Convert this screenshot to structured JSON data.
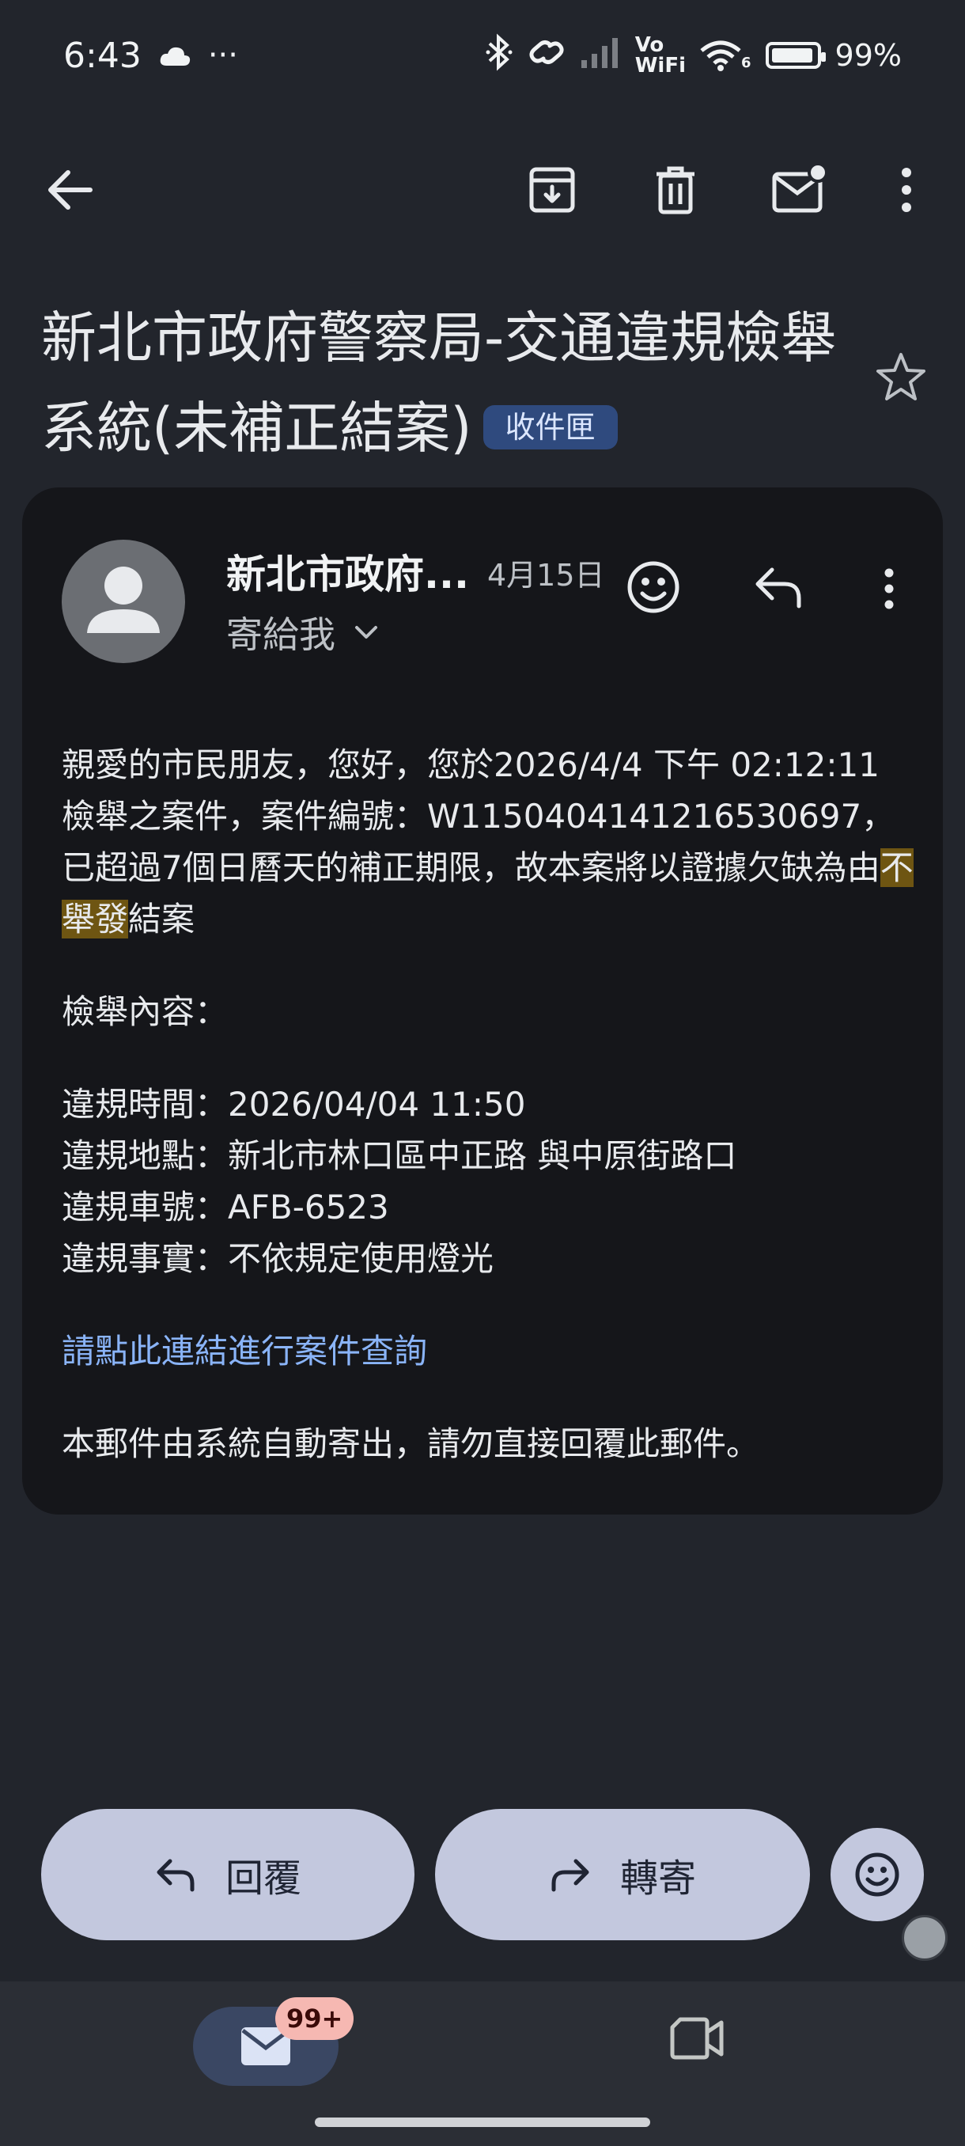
{
  "status_bar": {
    "time": "6:43",
    "more": "···",
    "vo": "Vo",
    "wifi_label": "WiFi",
    "wifi_gen": "6",
    "battery": "99%"
  },
  "email": {
    "subject": "新北市政府警察局-交通違規檢舉系統(未補正結案)",
    "label": "收件匣",
    "sender_name": "新北市政府...",
    "date": "4月15日",
    "recipient": "寄給我",
    "body": {
      "p1_pre": "親愛的市民朋友，您好，您於2026/4/4 下午 02:12:11 檢舉之案件，案件編號：W1150404141216530697，已超過7個日曆天的補正期限，故本案將以證據欠缺為由",
      "p1_highlight": "不舉發",
      "p1_post": "結案",
      "content_heading": "檢舉內容：",
      "lines": [
        "違規時間：2026/04/04 11:50",
        "違規地點：新北市林口區中正路 與中原街路口",
        "違規車號：AFB-6523",
        "違規事實：不依規定使用燈光"
      ],
      "link": "請點此連結進行案件查詢",
      "footer": "本郵件由系統自動寄出，請勿直接回覆此郵件。"
    }
  },
  "actions": {
    "reply": "回覆",
    "forward": "轉寄"
  },
  "bottom_nav": {
    "mail_badge": "99+"
  },
  "colors": {
    "background": "#22252c",
    "card": "#15161a",
    "link": "#8ab4f8",
    "pill": "#c3c8de",
    "label_chip": "#2f4a7e",
    "highlight": "#6e5512",
    "badge": "#f6b8b2"
  }
}
